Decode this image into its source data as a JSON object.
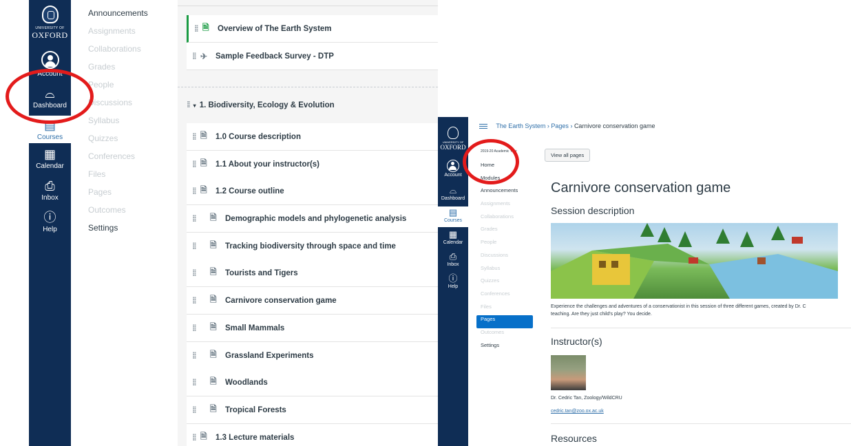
{
  "left_panel": {
    "logo": {
      "sub": "UNIVERSITY OF",
      "main": "OXFORD"
    },
    "global_nav": [
      {
        "label": "Account",
        "icon": "account-icon"
      },
      {
        "label": "Dashboard",
        "icon": "dashboard-icon"
      },
      {
        "label": "Courses",
        "icon": "courses-icon",
        "active": true
      },
      {
        "label": "Calendar",
        "icon": "calendar-icon"
      },
      {
        "label": "Inbox",
        "icon": "inbox-icon"
      },
      {
        "label": "Help",
        "icon": "help-icon"
      }
    ],
    "course_nav": [
      {
        "label": "Announcements",
        "enabled": true
      },
      {
        "label": "Assignments",
        "enabled": false
      },
      {
        "label": "Collaborations",
        "enabled": false
      },
      {
        "label": "Grades",
        "enabled": false
      },
      {
        "label": "People",
        "enabled": false
      },
      {
        "label": "Discussions",
        "enabled": false
      },
      {
        "label": "Syllabus",
        "enabled": false
      },
      {
        "label": "Quizzes",
        "enabled": false
      },
      {
        "label": "Conferences",
        "enabled": false
      },
      {
        "label": "Files",
        "enabled": false
      },
      {
        "label": "Pages",
        "enabled": false
      },
      {
        "label": "Outcomes",
        "enabled": false
      },
      {
        "label": "Settings",
        "enabled": true
      }
    ]
  },
  "modules": {
    "top_items": [
      {
        "title": "Overview of The Earth System",
        "icon": "page-icon"
      },
      {
        "title": "Sample Feedback Survey - DTP",
        "icon": "quiz-icon"
      }
    ],
    "module_header": "1. Biodiversity, Ecology & Evolution",
    "items": [
      {
        "title": "1.0 Course description",
        "indent": 0
      },
      {
        "title": "1.1 About your instructor(s)",
        "indent": 0
      },
      {
        "title": "1.2 Course outline",
        "indent": 0
      },
      {
        "title": "Demographic models and phylogenetic analysis",
        "indent": 1
      },
      {
        "title": "Tracking biodiversity through space and time",
        "indent": 1
      },
      {
        "title": "Tourists and Tigers",
        "indent": 1
      },
      {
        "title": "Carnivore conservation game",
        "indent": 1
      },
      {
        "title": "Small Mammals",
        "indent": 1
      },
      {
        "title": "Grassland Experiments",
        "indent": 1
      },
      {
        "title": "Woodlands",
        "indent": 1
      },
      {
        "title": "Tropical Forests",
        "indent": 1
      },
      {
        "title": "1.3 Lecture materials",
        "indent": 0
      }
    ]
  },
  "right_page": {
    "breadcrumb": {
      "course": "The Earth System",
      "section": "Pages",
      "current": "Carnivore conservation game"
    },
    "logo": {
      "sub": "UNIVERSITY OF",
      "main": "OXFORD"
    },
    "global_nav": [
      "Account",
      "Dashboard",
      "Courses",
      "Calendar",
      "Inbox",
      "Help"
    ],
    "term": "2019-20 Academic Year",
    "course_nav": [
      {
        "label": "Home",
        "enabled": true
      },
      {
        "label": "Modules",
        "enabled": true
      },
      {
        "label": "Announcements",
        "enabled": true
      },
      {
        "label": "Assignments",
        "enabled": false
      },
      {
        "label": "Collaborations",
        "enabled": false
      },
      {
        "label": "Grades",
        "enabled": false
      },
      {
        "label": "People",
        "enabled": false
      },
      {
        "label": "Discussions",
        "enabled": false
      },
      {
        "label": "Syllabus",
        "enabled": false
      },
      {
        "label": "Quizzes",
        "enabled": false
      },
      {
        "label": "Conferences",
        "enabled": false
      },
      {
        "label": "Files",
        "enabled": false
      },
      {
        "label": "Pages",
        "enabled": true,
        "selected": true
      },
      {
        "label": "Outcomes",
        "enabled": false
      },
      {
        "label": "Settings",
        "enabled": true
      }
    ],
    "view_all_label": "View all pages",
    "title": "Carnivore conservation game",
    "session_heading": "Session description",
    "description_line1": "Experience the challenges and adventures of a conservationist in this session of three different games, created by Dr. C",
    "description_line2": "teaching. Are they just child's play? You decide.",
    "instructor_heading": "Instructor(s)",
    "instructor_name": "Dr. Cedric Tan, Zoology/WildCRU",
    "instructor_email": "cedric.tan@zoo.ox.ac.uk",
    "resources_heading": "Resources"
  },
  "colors": {
    "nav_bg": "#0f2d55",
    "accent_green": "#1a9b43",
    "link_blue": "#2d6ea8",
    "selected_blue": "#0770c9",
    "annotation_red": "#e31b1b"
  }
}
